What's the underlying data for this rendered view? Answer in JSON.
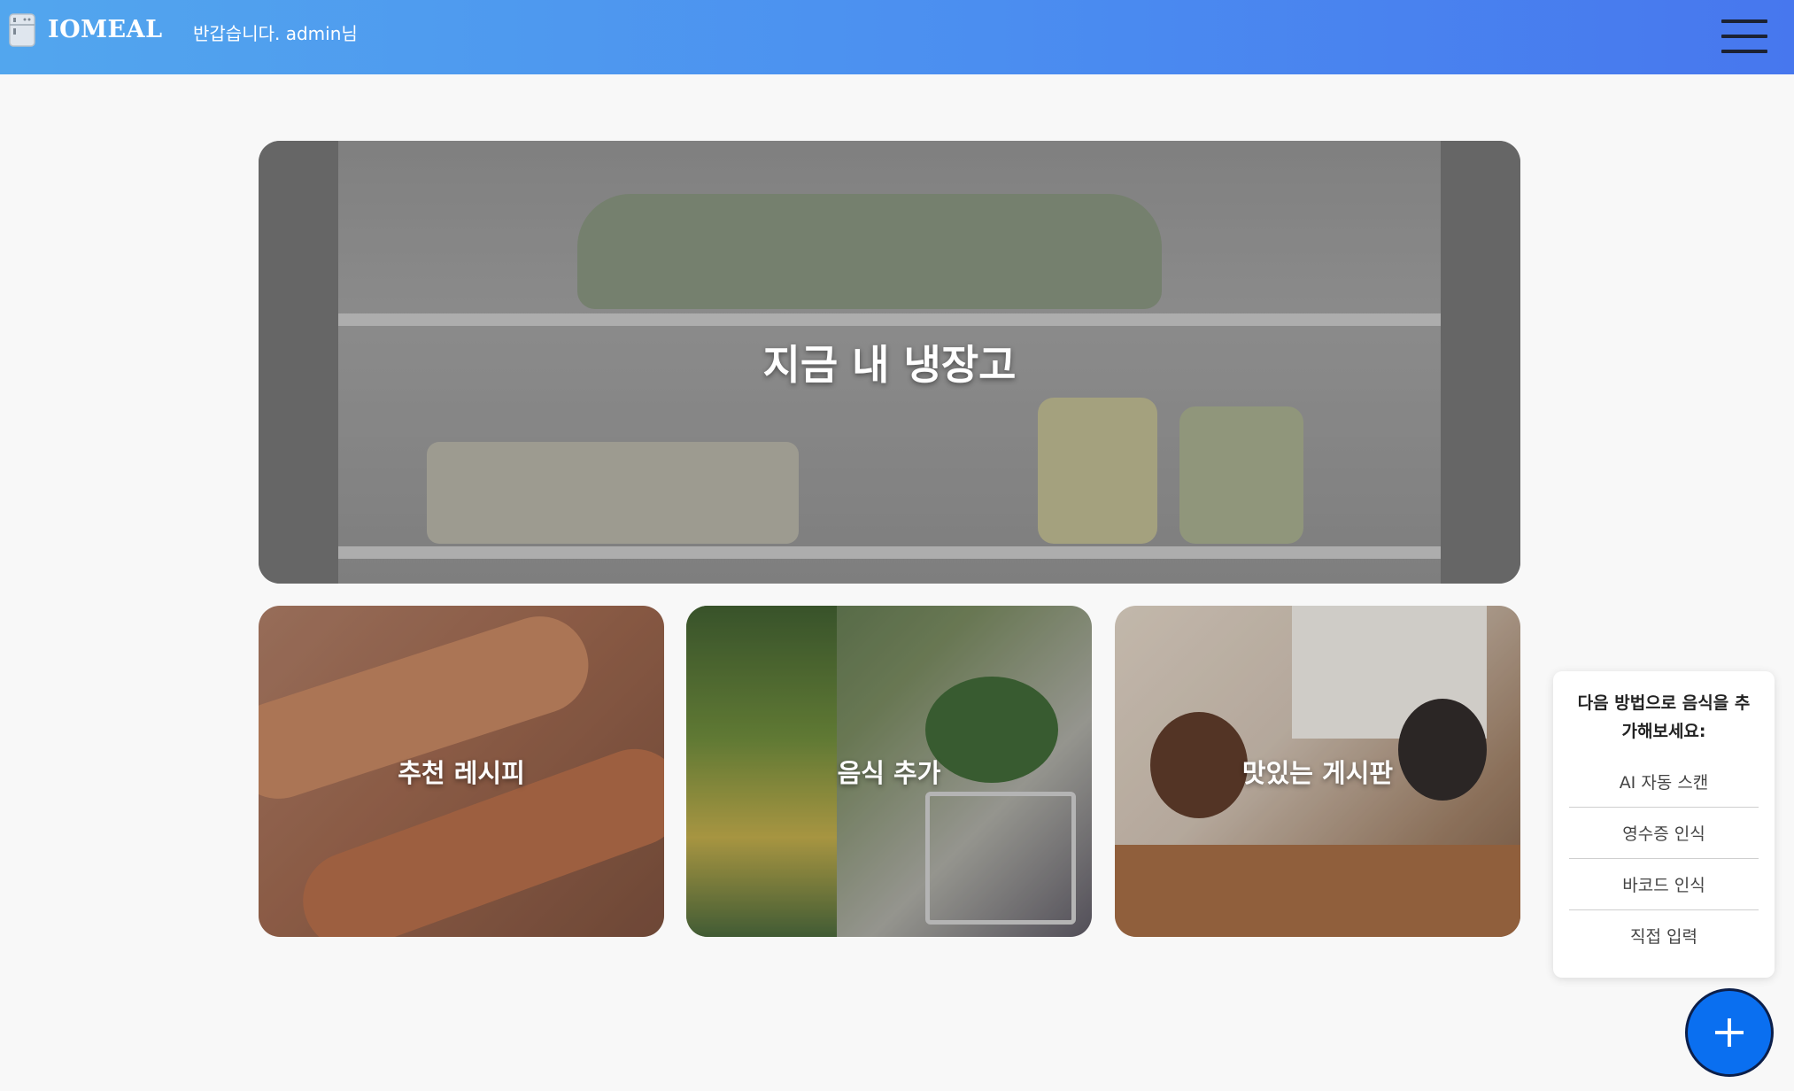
{
  "header": {
    "logo": "IOMEAL",
    "welcome": "반갑습니다. admin님"
  },
  "cards": {
    "fridge": "지금 내 냉장고",
    "recipe": "추천 레시피",
    "add_food": "음식 추가",
    "board": "맛있는 게시판"
  },
  "add_popup": {
    "title": "다음 방법으로 음식을 추가해보세요:",
    "options": [
      "AI 자동 스캔",
      "영수증 인식",
      "바코드 인식",
      "직접 입력"
    ]
  },
  "colors": {
    "header_start": "#52a6ee",
    "header_end": "#4777ee",
    "fab": "#0a6ff0"
  }
}
